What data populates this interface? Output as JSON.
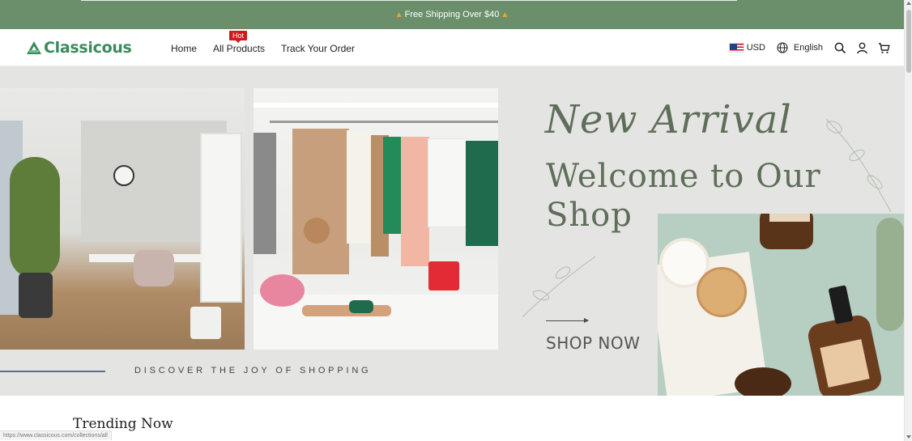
{
  "announcement": {
    "text": "Free Shipping Over $40"
  },
  "header": {
    "logo_text": "Classicous",
    "nav": [
      {
        "label": "Home"
      },
      {
        "label": "All Products",
        "badge": "Hot"
      },
      {
        "label": "Track Your Order"
      }
    ],
    "currency": "USD",
    "language": "English",
    "icons": [
      "globe-icon",
      "search-icon",
      "user-icon",
      "cart-icon"
    ]
  },
  "hero": {
    "script_title": "New Arrival",
    "headline": "Welcome to Our Shop",
    "cta": "SHOP NOW",
    "tagline": "DISCOVER THE JOY OF SHOPPING"
  },
  "section_title": "Trending Now",
  "status_url": "https://www.classicous.com/collections/all",
  "colors": {
    "announcement_bg": "#6b8f6b",
    "brand": "#3d8a5e",
    "hero_bg": "#e4e5e2",
    "hot_badge": "#d01a1a",
    "hero_text": "#5f6e5a"
  }
}
